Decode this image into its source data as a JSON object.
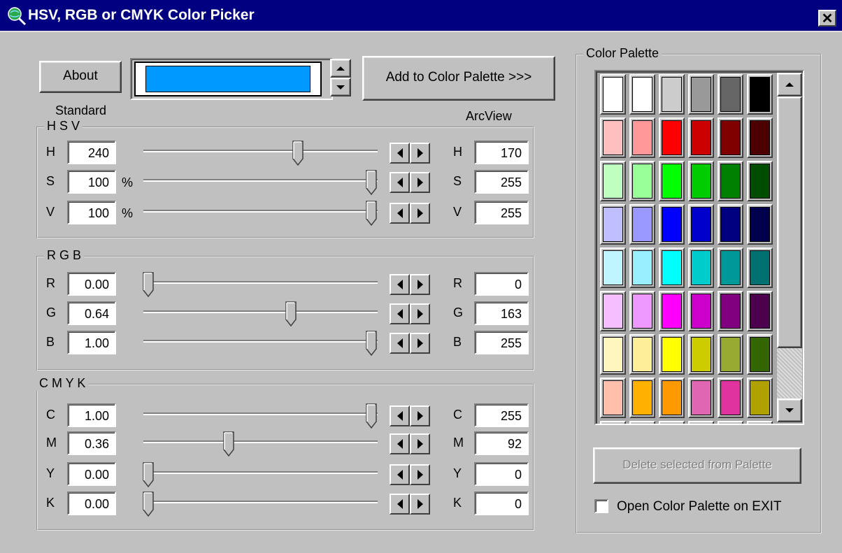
{
  "window": {
    "title": "HSV, RGB or CMYK Color Picker",
    "close": "✕"
  },
  "top": {
    "about": "About",
    "preview_color": "#0099ff",
    "add_palette": "Add  to Color Palette >>>",
    "standard": "Standard",
    "arcview": "ArcView"
  },
  "hsv": {
    "title": "H S V",
    "rows": [
      {
        "label": "H",
        "value": "240",
        "unit": "",
        "arc_label": "H",
        "arc": "170",
        "level": 0.67
      },
      {
        "label": "S",
        "value": "100",
        "unit": "%",
        "arc_label": "S",
        "arc": "255",
        "level": 1.0
      },
      {
        "label": "V",
        "value": "100",
        "unit": "%",
        "arc_label": "V",
        "arc": "255",
        "level": 1.0
      }
    ]
  },
  "rgb": {
    "title": "R G B",
    "rows": [
      {
        "label": "R",
        "value": "0.00",
        "arc_label": "R",
        "arc": "0",
        "level": 0.0
      },
      {
        "label": "G",
        "value": "0.64",
        "arc_label": "G",
        "arc": "163",
        "level": 0.64
      },
      {
        "label": "B",
        "value": "1.00",
        "arc_label": "B",
        "arc": "255",
        "level": 1.0
      }
    ]
  },
  "cmyk": {
    "title": "C M Y K",
    "rows": [
      {
        "label": "C",
        "value": "1.00",
        "arc_label": "C",
        "arc": "255",
        "level": 1.0
      },
      {
        "label": "M",
        "value": "0.36",
        "arc_label": "M",
        "arc": "92",
        "level": 0.36
      },
      {
        "label": "Y",
        "value": "0.00",
        "arc_label": "Y",
        "arc": "0",
        "level": 0.0
      },
      {
        "label": "K",
        "value": "0.00",
        "arc_label": "K",
        "arc": "0",
        "level": 0.0
      }
    ]
  },
  "palette": {
    "title": "Color Palette",
    "colors": [
      [
        "#ffffff",
        "#ffffff",
        "#cccccc",
        "#999999",
        "#666666",
        "#000000"
      ],
      [
        "#ffbfbf",
        "#ff9999",
        "#ff0000",
        "#cc0000",
        "#800000",
        "#4d0000"
      ],
      [
        "#bfffbf",
        "#99ff99",
        "#00ff00",
        "#00cc00",
        "#008000",
        "#004d00"
      ],
      [
        "#bfbfff",
        "#9999ff",
        "#0000ff",
        "#0000cc",
        "#000080",
        "#00004d"
      ],
      [
        "#bff5ff",
        "#99eeff",
        "#00ffff",
        "#00cccc",
        "#009999",
        "#007070"
      ],
      [
        "#f5bfff",
        "#ee99ff",
        "#ff00ff",
        "#cc00cc",
        "#800080",
        "#4d004d"
      ],
      [
        "#fff5bf",
        "#ffee99",
        "#ffff00",
        "#cccc00",
        "#99aa33",
        "#336600"
      ],
      [
        "#ffbfaa",
        "#ffb000",
        "#ff9900",
        "#e066b3",
        "#e033a0",
        "#b0a000"
      ]
    ],
    "delete_button": "Delete selected from Palette",
    "open_on_exit": "Open Color Palette on EXIT"
  },
  "icons": {
    "app": "globe-magnifier-icon",
    "close": "close-icon",
    "spin_up": "arrow-up-icon",
    "spin_down": "arrow-down-icon",
    "step_left": "arrow-left-icon",
    "step_right": "arrow-right-icon"
  }
}
